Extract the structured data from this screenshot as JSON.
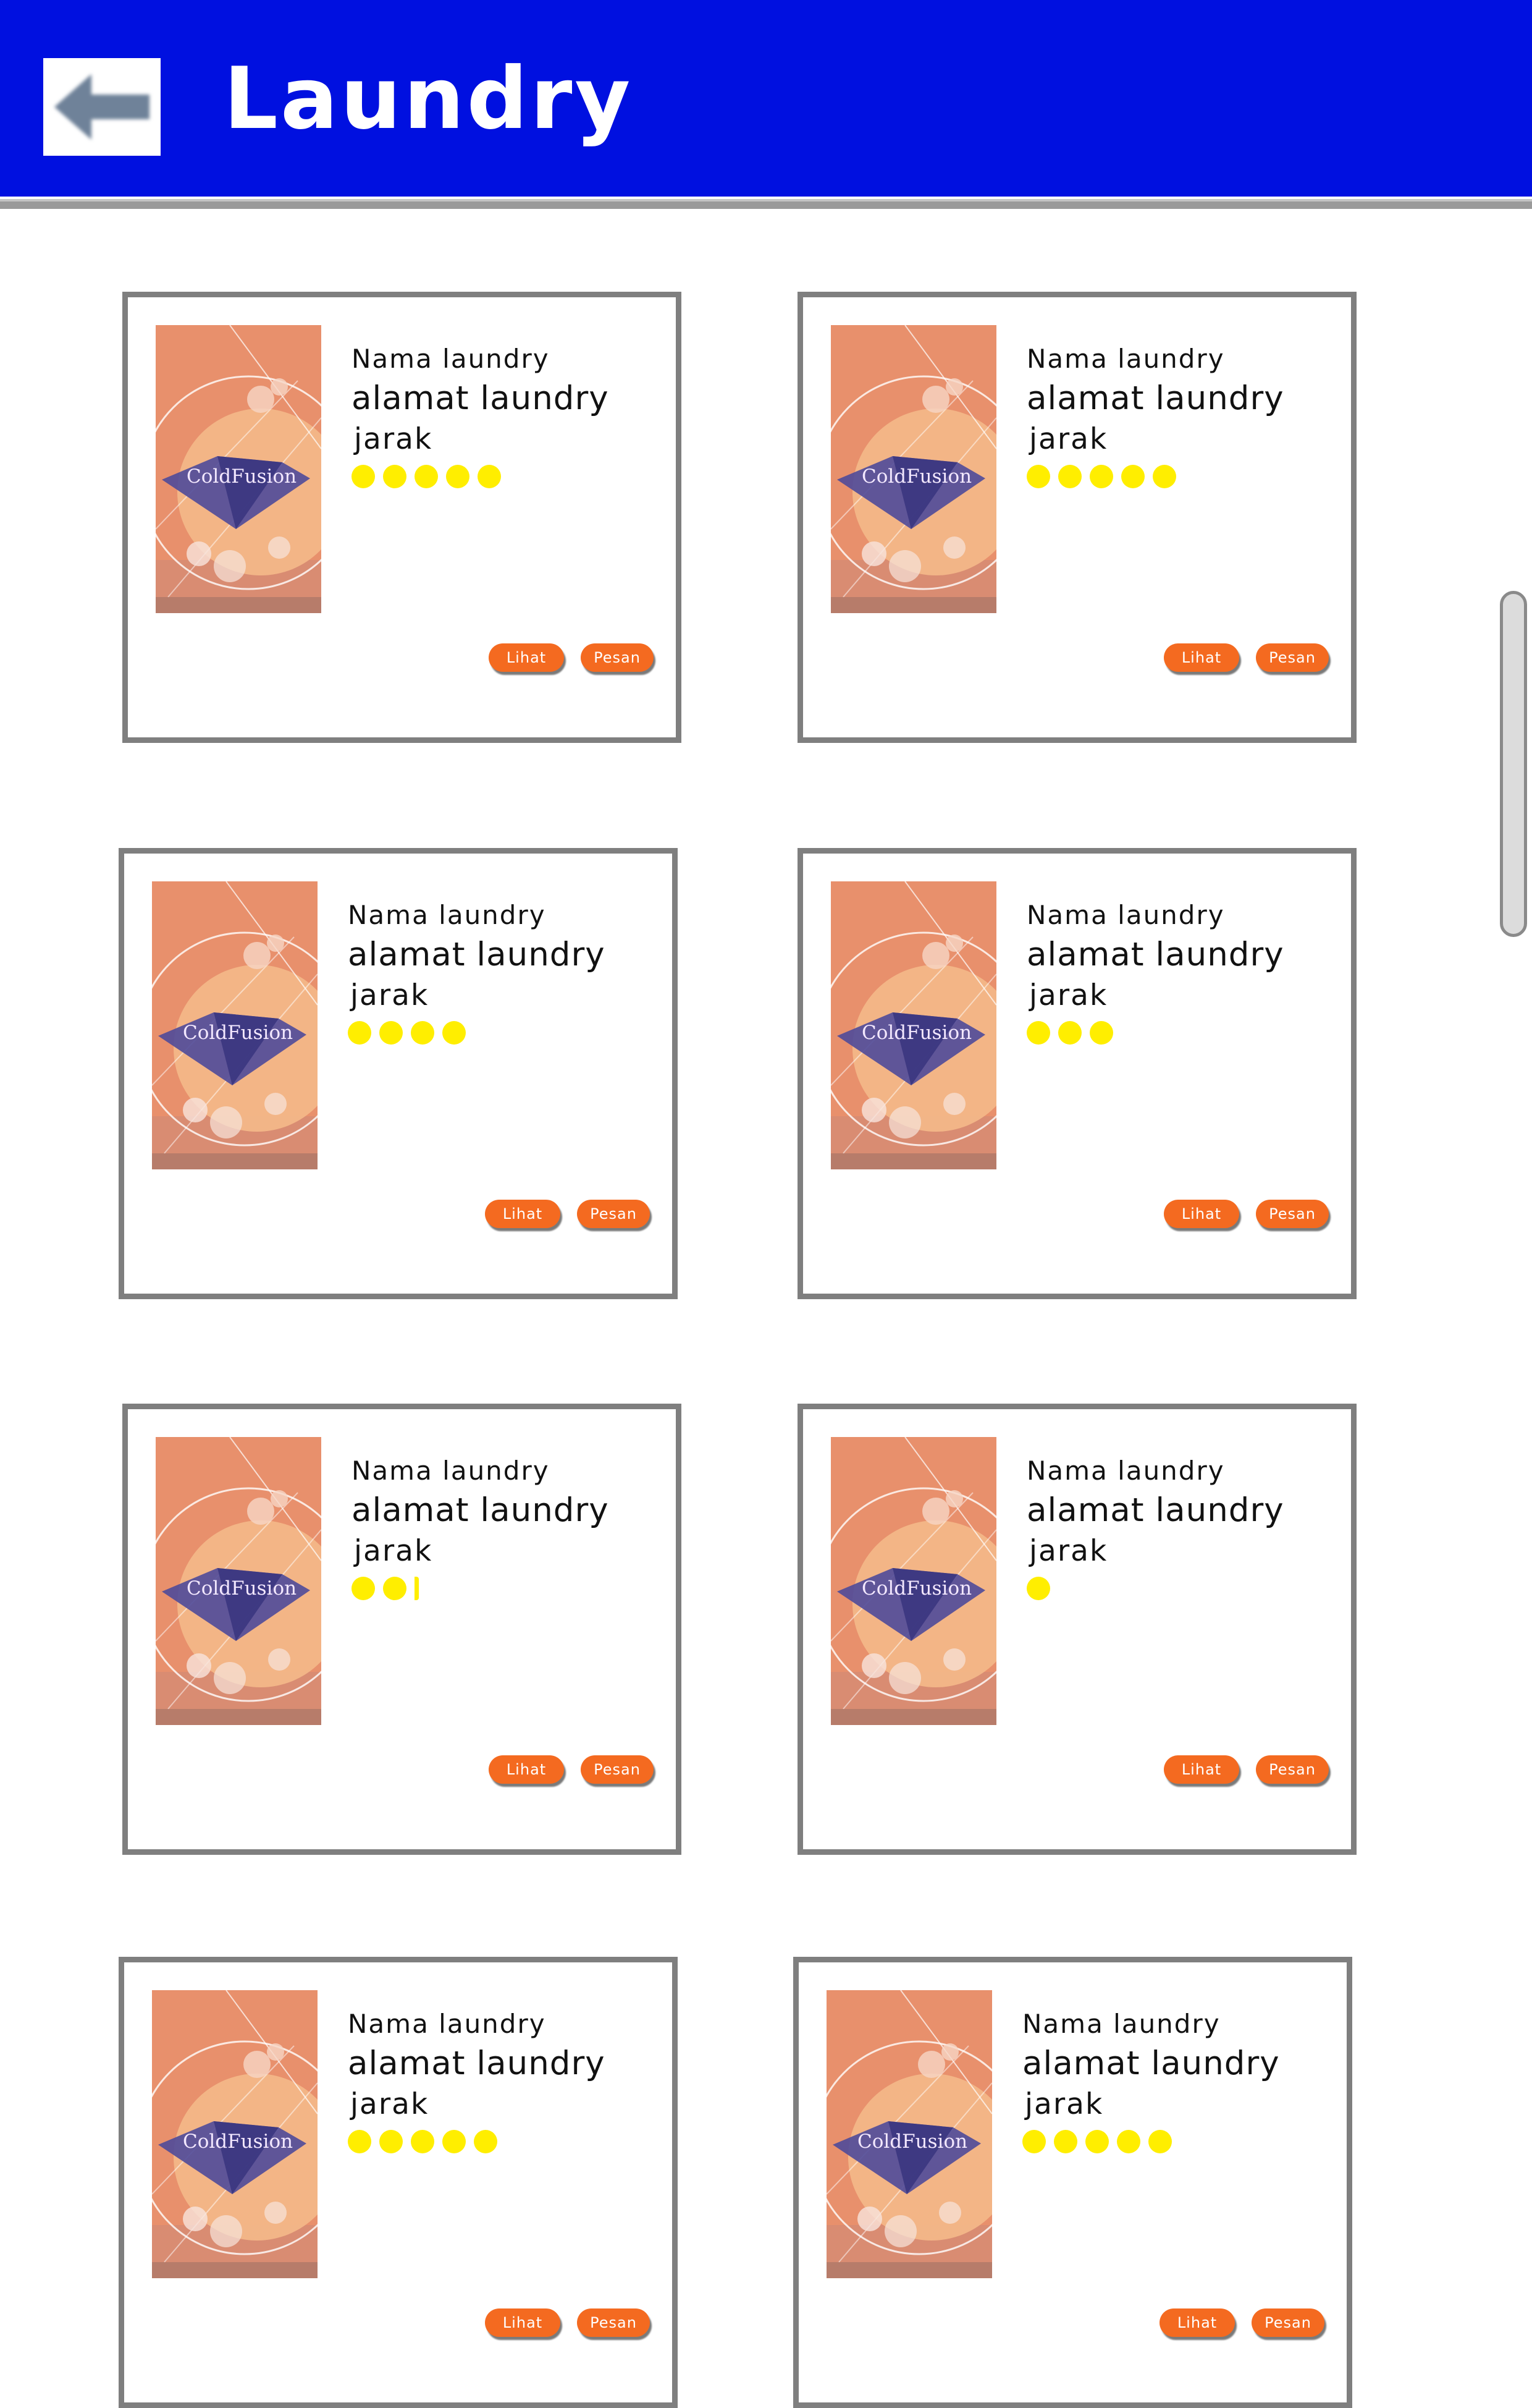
{
  "header": {
    "title": "Laundry",
    "back_icon": "arrow-left-icon",
    "background_color": "#0010e0"
  },
  "card_labels": {
    "view_button": "Lihat",
    "order_button": "Pesan"
  },
  "thumbnail": {
    "brand_text": "ColdFusion"
  },
  "colors": {
    "rating_dot": "#ffee00",
    "button": "#f46a20",
    "card_border": "#7f7f7f"
  },
  "cards": [
    {
      "name": "Nama laundry",
      "address": "alamat laundry",
      "distance": "jarak",
      "rating": 5
    },
    {
      "name": "Nama laundry",
      "address": "alamat laundry",
      "distance": "jarak",
      "rating": 5
    },
    {
      "name": "Nama laundry",
      "address": "alamat laundry",
      "distance": "jarak",
      "rating": 4
    },
    {
      "name": "Nama laundry",
      "address": "alamat laundry",
      "distance": "jarak",
      "rating": 3
    },
    {
      "name": "Nama laundry",
      "address": "alamat laundry",
      "distance": "jarak",
      "rating": 2.2
    },
    {
      "name": "Nama laundry",
      "address": "alamat laundry",
      "distance": "jarak",
      "rating": 1
    },
    {
      "name": "Nama laundry",
      "address": "alamat laundry",
      "distance": "jarak",
      "rating": 5
    },
    {
      "name": "Nama laundry",
      "address": "alamat laundry",
      "distance": "jarak",
      "rating": 5
    }
  ]
}
